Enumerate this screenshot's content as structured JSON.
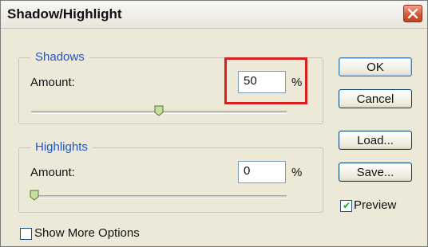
{
  "window": {
    "title": "Shadow/Highlight"
  },
  "shadows": {
    "legend": "Shadows",
    "amount_label": "Amount:",
    "amount_value": "50",
    "unit": "%",
    "slider_fraction": 0.5
  },
  "highlights": {
    "legend": "Highlights",
    "amount_label": "Amount:",
    "amount_value": "0",
    "unit": "%",
    "slider_fraction": 0.0
  },
  "buttons": {
    "ok": "OK",
    "cancel": "Cancel",
    "load": "Load...",
    "save": "Save..."
  },
  "preview": {
    "label": "Preview",
    "checked": true
  },
  "more_options": {
    "label": "Show More Options",
    "checked": false
  },
  "colors": {
    "legend_blue": "#1f55c8",
    "annotation_red": "#d62020",
    "close_red": "#d8583b"
  }
}
